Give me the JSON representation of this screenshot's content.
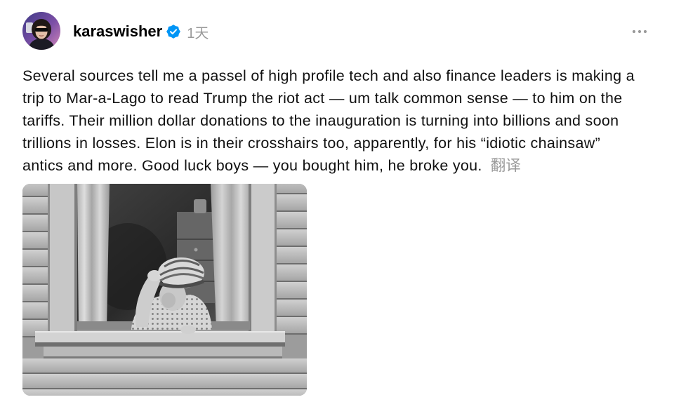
{
  "post": {
    "author": {
      "username": "karaswisher",
      "verified": true
    },
    "timestamp": "1天",
    "body_lines": [
      "Several sources tell me a passel of high profile tech and also finance leaders is making a",
      "trip to Mar-a-Lago to read Trump the riot act — um talk common sense — to him on the",
      "tariffs. Their million dollar donations to the inauguration is turning into billions and soon",
      "trillions in losses. Elon is in their crosshairs too, apparently, for his “idiotic chainsaw”",
      "antics and more. Good luck boys — you bought him, he broke you."
    ],
    "translate_label": "翻译"
  },
  "icons": {
    "avatar": "avatar",
    "verified": "verified-badge-icon",
    "more": "more-horizontal-icon"
  },
  "colors": {
    "text": "#111111",
    "secondary_text": "#999999",
    "verified": "#0095f6",
    "background": "#ffffff"
  }
}
